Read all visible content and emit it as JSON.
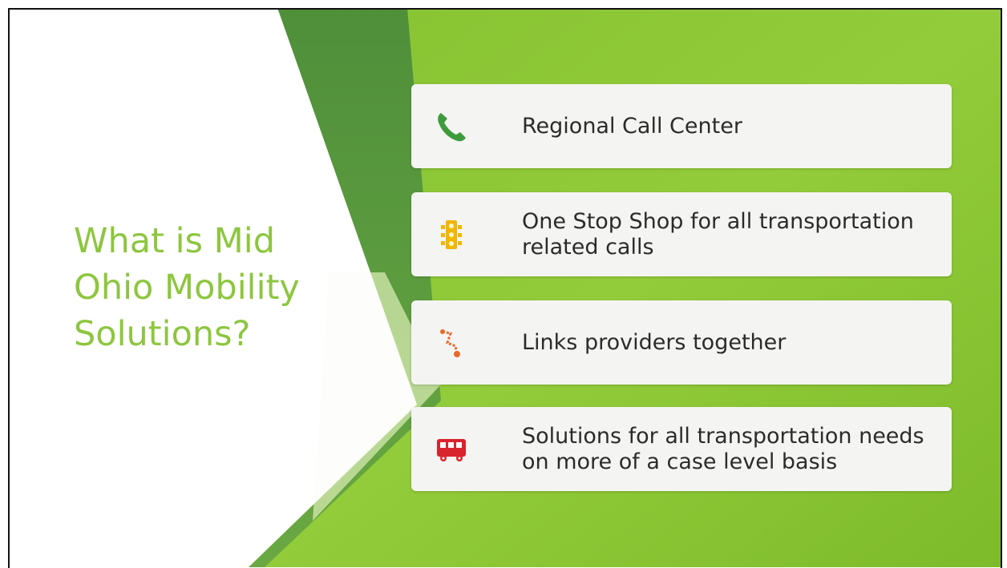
{
  "slide": {
    "title": "What is Mid Ohio Mobility Solutions?",
    "items": [
      {
        "icon": "phone-icon",
        "icon_color": "#3e9b3c",
        "text": "Regional Call Center"
      },
      {
        "icon": "traffic-light-icon",
        "icon_color": "#f2b600",
        "text": "One Stop Shop for all transportation related calls"
      },
      {
        "icon": "route-icon",
        "icon_color": "#e8692b",
        "text": "Links providers together"
      },
      {
        "icon": "bus-icon",
        "icon_color": "#d9232d",
        "text": "Solutions for all transportation needs on more of a case level basis"
      }
    ]
  },
  "colors": {
    "title": "#8dc63f",
    "green_bright": "#8dc63f",
    "green_dark": "#5a9a3c",
    "card": "#f4f4f2"
  }
}
